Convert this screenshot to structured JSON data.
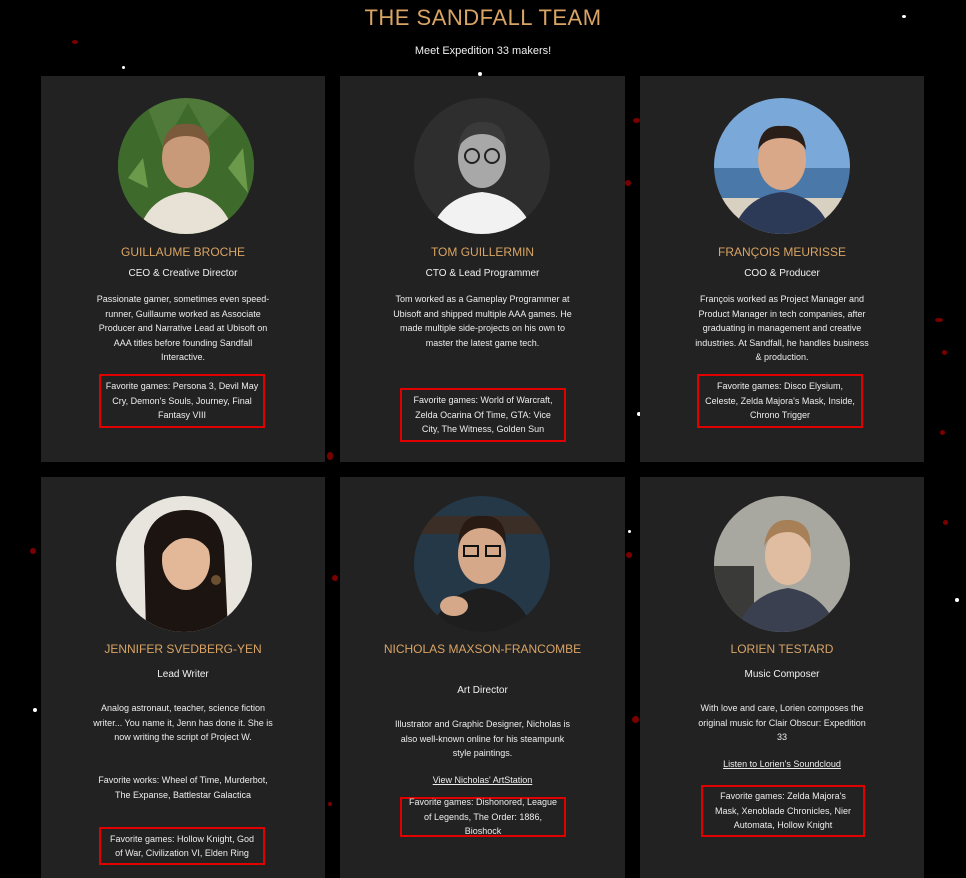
{
  "header": {
    "title": "THE SANDFALL TEAM",
    "subtitle": "Meet Expedition 33 makers!"
  },
  "colors": {
    "accent": "#d9a464",
    "card_bg": "#222222",
    "highlight_box": "#e00000",
    "particle_red": "#7a0000"
  },
  "team": [
    {
      "name": "GUILLAUME BROCHE",
      "role": "CEO & Creative Director",
      "bio": "Passionate gamer, sometimes even speed-runner, Guillaume worked as Associate Producer and Narrative Lead at Ubisoft on AAA titles before founding Sandfall Interactive.",
      "favorites": "Favorite games: Persona 3, Devil May Cry, Demon's Souls, Journey, Final Fantasy VIII"
    },
    {
      "name": "TOM GUILLERMIN",
      "role": "CTO & Lead Programmer",
      "bio": "Tom worked as a Gameplay Programmer at Ubisoft and shipped multiple AAA games. He made multiple side-projects on his own to master the latest game tech.",
      "favorites": "Favorite games: World of Warcraft, Zelda Ocarina Of Time, GTA: Vice City, The Witness, Golden Sun"
    },
    {
      "name": "FRANÇOIS MEURISSE",
      "role": "COO & Producer",
      "bio": "François worked as Project Manager and Product Manager in tech companies, after graduating in management and creative industries. At Sandfall, he handles business & production.",
      "favorites": "Favorite games: Disco Elysium, Celeste, Zelda Majora's Mask, Inside, Chrono Trigger"
    },
    {
      "name": "JENNIFER SVEDBERG-YEN",
      "role": "Lead Writer",
      "bio": "Analog astronaut, teacher, science fiction writer... You name it, Jenn has done it. She is now writing the script of Project W.",
      "works": "Favorite works: Wheel of Time, Murderbot, The Expanse, Battlestar Galactica",
      "favorites": "Favorite games: Hollow Knight, God of War, Civilization VI, Elden Ring"
    },
    {
      "name": "NICHOLAS MAXSON-FRANCOMBE",
      "role": "Art Director",
      "bio": "Illustrator and Graphic Designer, Nicholas is also well-known online for his steampunk style paintings.",
      "link": "View Nicholas' ArtStation",
      "favorites": "Favorite games: Dishonored, League of Legends, The Order: 1886, Bioshock"
    },
    {
      "name": "LORIEN TESTARD",
      "role": "Music Composer",
      "bio": "With love and care, Lorien composes the original music for Clair Obscur: Expedition 33",
      "link": "Listen to Lorien's Soundcloud",
      "favorites": "Favorite games: Zelda Majora's Mask, Xenoblade Chronicles, Nier Automata, Hollow Knight"
    }
  ]
}
